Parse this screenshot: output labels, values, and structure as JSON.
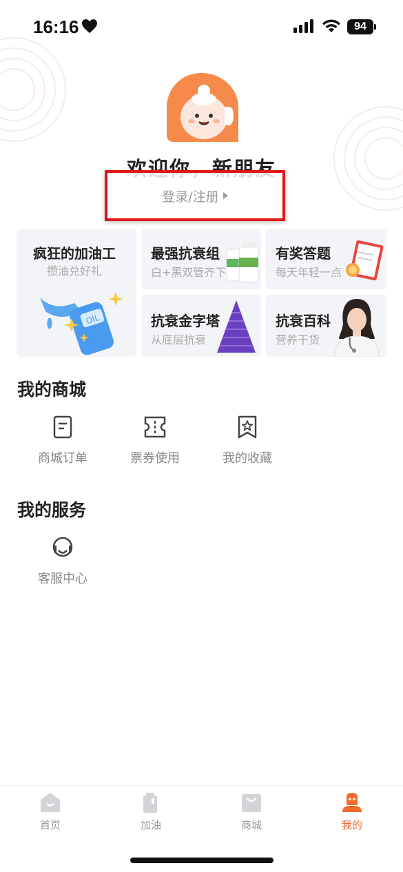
{
  "status": {
    "time": "16:16",
    "battery": "94"
  },
  "header": {
    "welcome": "欢迎你，新朋友",
    "login": "登录/注册"
  },
  "promos": [
    {
      "title": "疯狂的加油工",
      "subtitle": "攒油兑好礼",
      "icon": "oil-nozzle-icon"
    },
    {
      "title": "最强抗衰组",
      "subtitle": "白+黑双管齐下",
      "icon": "supplement-bottles-icon"
    },
    {
      "title": "有奖答题",
      "subtitle": "每天年轻一点",
      "icon": "quiz-clipboard-icon"
    },
    {
      "title": "抗衰金字塔",
      "subtitle": "从底层抗衰",
      "icon": "pyramid-icon"
    },
    {
      "title": "抗衰百科",
      "subtitle": "营养干货",
      "icon": "doctor-icon"
    }
  ],
  "mall": {
    "title": "我的商城",
    "items": [
      {
        "label": "商城订单",
        "icon": "order-icon"
      },
      {
        "label": "票券使用",
        "icon": "ticket-icon"
      },
      {
        "label": "我的收藏",
        "icon": "favorite-icon"
      }
    ]
  },
  "service": {
    "title": "我的服务",
    "items": [
      {
        "label": "客服中心",
        "icon": "headset-icon"
      }
    ]
  },
  "tabs": [
    {
      "label": "首页",
      "icon": "home-icon"
    },
    {
      "label": "加油",
      "icon": "fuel-icon"
    },
    {
      "label": "商城",
      "icon": "shop-bag-icon"
    },
    {
      "label": "我的",
      "icon": "profile-icon",
      "active": true
    }
  ],
  "colors": {
    "accent": "#f26a2b",
    "highlight_box": "#e3141a"
  }
}
